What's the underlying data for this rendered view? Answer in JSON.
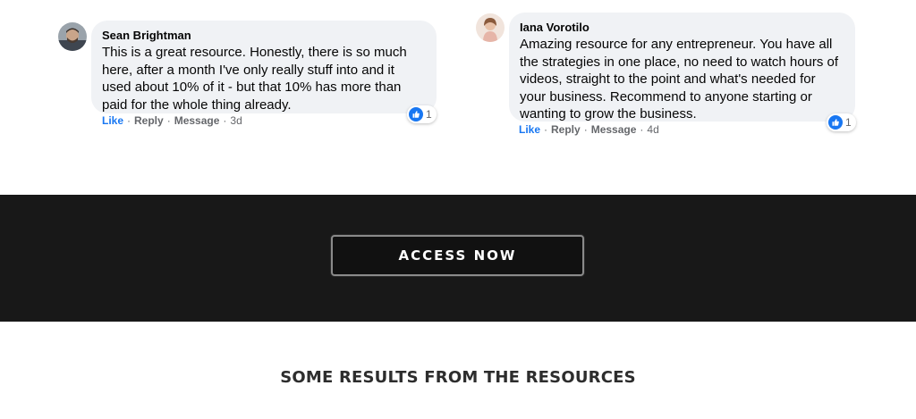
{
  "comments": [
    {
      "author": "Sean Brightman",
      "text": "This is a great resource. Honestly, there is so much here, after a month I've only really stuff into and it used about 10% of it - but that 10% has more than paid for the whole thing already.",
      "actions": {
        "like": "Like",
        "reply": "Reply",
        "message": "Message",
        "time": "3d"
      },
      "reaction_count": "1"
    },
    {
      "author": "Iana Vorotilo",
      "text": "Amazing resource for any entrepreneur. You have all the strategies in one place, no need to watch hours of videos, straight to the point and what's needed for your business. Recommend to anyone starting or wanting to grow the business.",
      "actions": {
        "like": "Like",
        "reply": "Reply",
        "message": "Message",
        "time": "4d"
      },
      "reaction_count": "1"
    }
  ],
  "cta": {
    "label": "ACCESS NOW"
  },
  "results_section": {
    "title": "SOME RESULTS FROM THE RESOURCES"
  },
  "colors": {
    "band": "#181818",
    "bubble": "#f0f2f5",
    "like_blue": "#1877f2",
    "meta_gray": "#65676b"
  },
  "icons": {
    "reaction": "thumbs-up-icon",
    "avatar": "user-avatar"
  }
}
